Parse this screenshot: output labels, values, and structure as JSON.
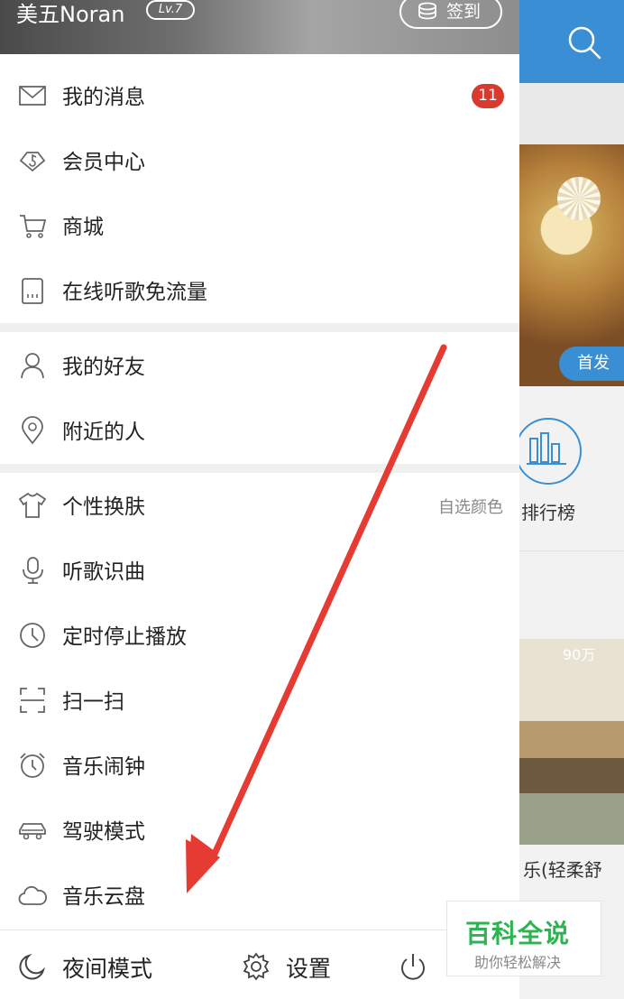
{
  "header": {
    "user_name": "美五Noran",
    "level": "Lv.7",
    "checkin_label": "签到"
  },
  "menu": {
    "group1": [
      {
        "label": "我的消息",
        "badge": "11"
      },
      {
        "label": "会员中心"
      },
      {
        "label": "商城"
      },
      {
        "label": "在线听歌免流量"
      }
    ],
    "group2": [
      {
        "label": "我的好友"
      },
      {
        "label": "附近的人"
      }
    ],
    "group3": [
      {
        "label": "个性换肤",
        "right": "自选颜色"
      },
      {
        "label": "听歌识曲"
      },
      {
        "label": "定时停止播放"
      },
      {
        "label": "扫一扫"
      },
      {
        "label": "音乐闹钟"
      },
      {
        "label": "驾驶模式"
      },
      {
        "label": "音乐云盘"
      }
    ]
  },
  "bottom_bar": {
    "night_mode": "夜间模式",
    "settings": "设置"
  },
  "background": {
    "badge": "首发",
    "rank_label": "排行榜",
    "play_count": "90万",
    "song_fragment": "乐(轻柔舒"
  },
  "watermark": {
    "title": "百科全说",
    "subtitle": "助你轻松解决"
  },
  "colors": {
    "accent_blue": "#3a8fd4",
    "badge_red": "#d83b2d",
    "annotation_red": "#e53b32",
    "watermark_green": "#2fb352"
  }
}
